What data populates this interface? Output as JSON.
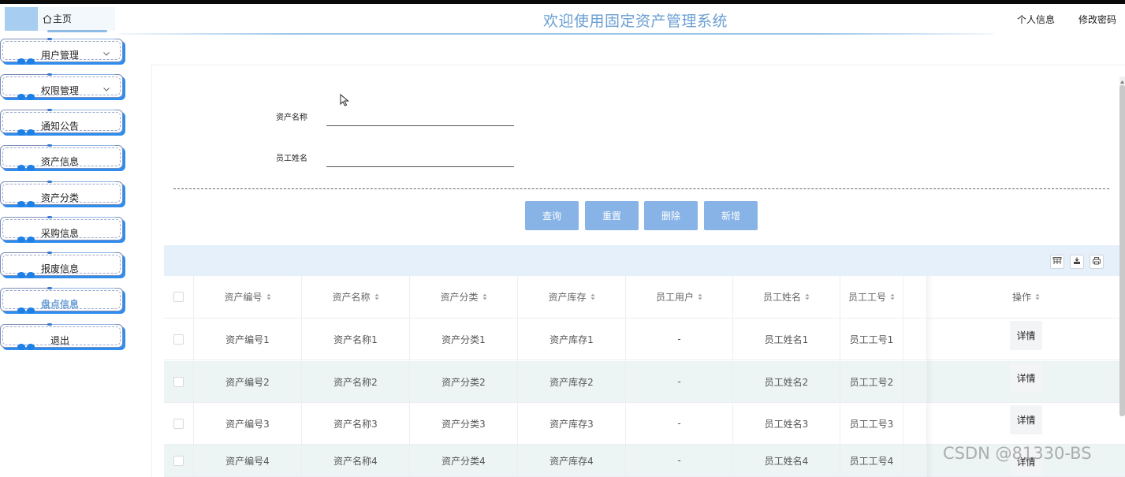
{
  "header": {
    "home_label": "主页",
    "title": "欢迎使用固定资产管理系统",
    "profile_link": "个人信息",
    "password_link": "修改密码"
  },
  "sidebar": {
    "items": [
      {
        "label": "用户管理",
        "has_arrow": true
      },
      {
        "label": "权限管理",
        "has_arrow": true
      },
      {
        "label": "通知公告"
      },
      {
        "label": "资产信息"
      },
      {
        "label": "资产分类"
      },
      {
        "label": "采购信息"
      },
      {
        "label": "报废信息"
      },
      {
        "label": "盘点信息",
        "active": true
      },
      {
        "label": "退出"
      }
    ]
  },
  "search": {
    "asset_name_label": "资产名称",
    "asset_name_value": "",
    "employee_name_label": "员工姓名",
    "employee_name_value": ""
  },
  "buttons": {
    "query": "查询",
    "reset": "重置",
    "delete": "删除",
    "add": "新增"
  },
  "toolbar_icons": [
    "columns-filter-icon",
    "export-icon",
    "print-icon"
  ],
  "table": {
    "columns": [
      "资产编号",
      "资产名称",
      "资产分类",
      "资产库存",
      "员工用户",
      "员工姓名",
      "员工工号",
      "操作"
    ],
    "action_label": "详情",
    "rows": [
      {
        "code": "资产编号1",
        "name": "资产名称1",
        "category": "资产分类1",
        "stock": "资产库存1",
        "user": "-",
        "emp_name": "员工姓名1",
        "emp_no": "员工工号1"
      },
      {
        "code": "资产编号2",
        "name": "资产名称2",
        "category": "资产分类2",
        "stock": "资产库存2",
        "user": "-",
        "emp_name": "员工姓名2",
        "emp_no": "员工工号2"
      },
      {
        "code": "资产编号3",
        "name": "资产名称3",
        "category": "资产分类3",
        "stock": "资产库存3",
        "user": "-",
        "emp_name": "员工姓名3",
        "emp_no": "员工工号3"
      },
      {
        "code": "资产编号4",
        "name": "资产名称4",
        "category": "资产分类4",
        "stock": "资产库存4",
        "user": "-",
        "emp_name": "员工姓名4",
        "emp_no": "员工工号4"
      }
    ]
  },
  "colors": {
    "accent": "#6b9fd4",
    "button": "#87b3e6",
    "sidebar_shadow": "#2f8df0",
    "toolbar_bg": "#e5f0fb",
    "row_alt": "#ecf4f4"
  },
  "watermark": "CSDN @81330-BS"
}
